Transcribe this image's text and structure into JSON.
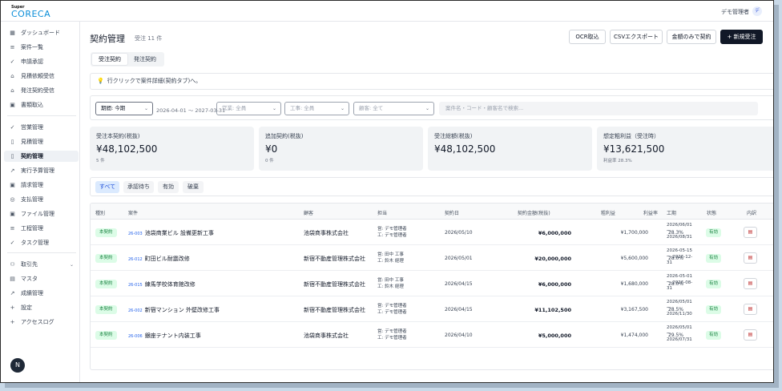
{
  "app": {
    "logo_small": "Super",
    "logo_big": "CORECA"
  },
  "user": {
    "name": "デモ管理者",
    "avatar": "デ"
  },
  "sidebar": {
    "items": [
      {
        "label": "ダッシュボード",
        "icon": "grid-icon"
      },
      {
        "label": "案件一覧",
        "icon": "list-icon"
      },
      {
        "label": "申請承認",
        "icon": "check-icon"
      },
      {
        "label": "見積依頼受信",
        "icon": "inbox-icon"
      },
      {
        "label": "発注契約受信",
        "icon": "inbox-icon"
      },
      {
        "label": "書類取込",
        "icon": "doc-icon"
      },
      {
        "label": "営業管理",
        "icon": "check-icon"
      },
      {
        "label": "見積管理",
        "icon": "file-icon"
      },
      {
        "label": "契約管理",
        "icon": "file-icon"
      },
      {
        "label": "実行予算管理",
        "icon": "trend-icon"
      },
      {
        "label": "請求管理",
        "icon": "doc-icon"
      },
      {
        "label": "支払管理",
        "icon": "circle-icon"
      },
      {
        "label": "ファイル管理",
        "icon": "doc-icon"
      },
      {
        "label": "工程管理",
        "icon": "list-icon"
      },
      {
        "label": "タスク管理",
        "icon": "check-icon"
      },
      {
        "label": "取引先",
        "icon": "users-icon"
      },
      {
        "label": "マスタ",
        "icon": "table-icon"
      },
      {
        "label": "成績管理",
        "icon": "trend-icon"
      },
      {
        "label": "設定",
        "icon": "plus-icon"
      },
      {
        "label": "アクセスログ",
        "icon": "plus-icon"
      }
    ],
    "bottom_badge": "N"
  },
  "header": {
    "title": "契約管理",
    "count": "受注 11 件",
    "buttons": {
      "ocr": "OCR取込",
      "csv": "CSVエクスポート",
      "amount_only": "金額のみで契約",
      "new": "+ 新規受注"
    }
  },
  "tabs": [
    "受注契約",
    "発注契約"
  ],
  "hint": "行クリックで案件詳細(契約タブ)へ。",
  "filters": {
    "period": "期間: 今期",
    "date_range": "2026-04-01 〜 2027-03-31",
    "sales": "営業: 全員",
    "construction": "工事: 全員",
    "customer": "顧客: 全て",
    "search_placeholder": "案件名・コード・顧客名で検索..."
  },
  "stats": [
    {
      "label": "受注本契約(税抜)",
      "value": "¥48,102,500",
      "sub": "5 件"
    },
    {
      "label": "追加契約(税抜)",
      "value": "¥0",
      "sub": "0 件"
    },
    {
      "label": "受注総額(税抜)",
      "value": "¥48,102,500",
      "sub": ""
    },
    {
      "label": "想定粗利益（受注時）",
      "value": "¥13,621,500",
      "sub": "利益率 28.3%"
    }
  ],
  "status_filters": [
    "すべて",
    "承認待ち",
    "有効",
    "破棄"
  ],
  "table": {
    "headers": [
      "種別",
      "案件",
      "顧客",
      "担当",
      "契約日",
      "契約金額(税抜)",
      "粗利益",
      "利益率",
      "工期",
      "状態",
      "内訳"
    ],
    "rows": [
      {
        "type": "本契約",
        "code": "26-003",
        "project": "池袋商業ビル 設備更新工事",
        "client": "池袋商事株式会社",
        "person_sales": "営: デモ管理者",
        "person_const": "工: デモ管理者",
        "date": "2026/05/10",
        "amount": "¥6,000,000",
        "gross": "¥1,700,000",
        "rate": "28.3%",
        "term1": "2026/06/01",
        "term2": "〜",
        "term3": "2026/08/31",
        "status": "有効"
      },
      {
        "type": "本契約",
        "code": "26-012",
        "project": "町田ビル耐震改修",
        "client": "新宿不動産管理株式会社",
        "person_sales": "営: 田中 工事",
        "person_const": "工: 鈴木 経理",
        "date": "2026/05/01",
        "amount": "¥20,000,000",
        "gross": "¥5,600,000",
        "rate": "28.0%",
        "term1": "2026-05-15",
        "term2": "〜 2026-12-",
        "term3": "31",
        "status": "有効"
      },
      {
        "type": "本契約",
        "code": "26-015",
        "project": "練馬学校体育館改修",
        "client": "新宿不動産管理株式会社",
        "person_sales": "営: 田中 工事",
        "person_const": "工: 鈴木 経理",
        "date": "2026/04/15",
        "amount": "¥6,000,000",
        "gross": "¥1,680,000",
        "rate": "28.0%",
        "term1": "2026-05-01",
        "term2": "〜 2026-08-",
        "term3": "31",
        "status": "有効"
      },
      {
        "type": "本契約",
        "code": "26-002",
        "project": "新宿マンション 外壁改修工事",
        "client": "新宿不動産管理株式会社",
        "person_sales": "営: デモ管理者",
        "person_const": "工: デモ管理者",
        "date": "2026/04/15",
        "amount": "¥11,102,500",
        "gross": "¥3,167,500",
        "rate": "28.5%",
        "term1": "2026/05/01",
        "term2": "〜",
        "term3": "2026/11/30",
        "status": "有効"
      },
      {
        "type": "本契約",
        "code": "26-006",
        "project": "銀座テナント内装工事",
        "client": "池袋商事株式会社",
        "person_sales": "営: デモ管理者",
        "person_const": "工: デモ管理者",
        "date": "2026/04/10",
        "amount": "¥5,000,000",
        "gross": "¥1,474,000",
        "rate": "29.5%",
        "term1": "2026/05/01",
        "term2": "〜",
        "term3": "2026/07/31",
        "status": "有効"
      }
    ]
  }
}
